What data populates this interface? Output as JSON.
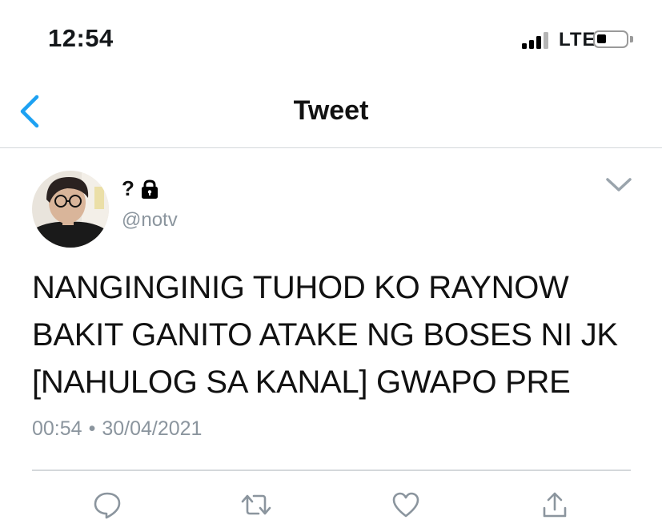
{
  "status_bar": {
    "time": "12:54",
    "network": "LTE",
    "signal_icon": "signal-strength-icon",
    "battery_icon": "battery-icon",
    "battery_level": 0.3
  },
  "nav": {
    "title": "Tweet",
    "back_icon": "chevron-left-icon"
  },
  "tweet": {
    "display_name": "?",
    "protected_icon": "lock-icon",
    "handle": "@notv",
    "text_lines": [
      "NANGINGINIG TUHOD KO RAYNOW",
      "BAKIT GANITO ATAKE NG BOSES NI JK",
      "[NAHULOG SA KANAL] GWAPO PRE"
    ],
    "time": "00:54",
    "separator": "•",
    "date": "30/04/2021",
    "menu_icon": "chevron-down-icon"
  },
  "actions": [
    {
      "name": "reply",
      "icon": "reply-icon"
    },
    {
      "name": "retweet",
      "icon": "retweet-icon"
    },
    {
      "name": "like",
      "icon": "heart-icon"
    },
    {
      "name": "share",
      "icon": "share-icon"
    }
  ],
  "colors": {
    "accent": "#1da1f2",
    "text": "#14171a",
    "secondary": "#8b959e",
    "border": "#d4d8db"
  }
}
